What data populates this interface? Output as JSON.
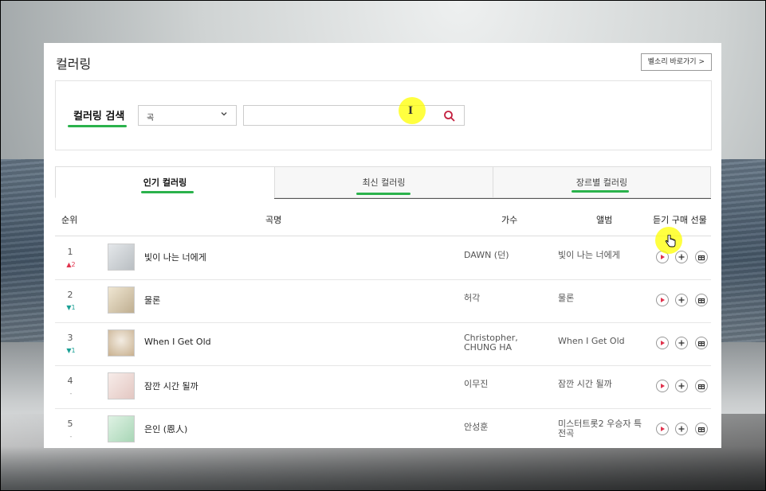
{
  "page": {
    "title": "컬러링",
    "shortcut_button": "벨소리 바로가기 >"
  },
  "search": {
    "label": "컬러링 검색",
    "select_value": "곡",
    "input_value": "",
    "search_icon": "search-icon"
  },
  "tabs": [
    {
      "label": "인기 컬러링",
      "active": true
    },
    {
      "label": "최신 컬러링",
      "active": false
    },
    {
      "label": "장르별 컬러링",
      "active": false
    }
  ],
  "columns": {
    "rank": "순위",
    "song": "곡명",
    "artist": "가수",
    "album": "앨범",
    "actions": "듣기 구매 선물"
  },
  "rows": [
    {
      "rank": "1",
      "delta": "2",
      "delta_dir": "up",
      "song": "빛이 나는 너에게",
      "artist": "DAWN (던)",
      "album": "빛이 나는 너에게",
      "thumb_color": "#cfd3d6"
    },
    {
      "rank": "2",
      "delta": "1",
      "delta_dir": "down",
      "song": "물론",
      "artist": "허각",
      "album": "물론",
      "thumb_color": "#d9cbb3"
    },
    {
      "rank": "3",
      "delta": "1",
      "delta_dir": "down",
      "song": "When I Get Old",
      "artist": "Christopher, CHUNG HA",
      "album": "When I Get Old",
      "thumb_color": "#e3d7c6"
    },
    {
      "rank": "4",
      "delta": "-",
      "delta_dir": "same",
      "song": "잠깐 시간 될까",
      "artist": "이무진",
      "album": "잠깐 시간 될까",
      "thumb_color": "#f1e3e0"
    },
    {
      "rank": "5",
      "delta": "-",
      "delta_dir": "same",
      "song": "은인 (恩人)",
      "artist": "안성훈",
      "album": "미스터트롯2 우승자 특전곡",
      "thumb_color": "#c8e6d0"
    }
  ],
  "colors": {
    "accent_green": "#2bb24c",
    "play_red": "#e0334d",
    "rank_up": "#e0334d",
    "rank_down": "#1aa095"
  }
}
